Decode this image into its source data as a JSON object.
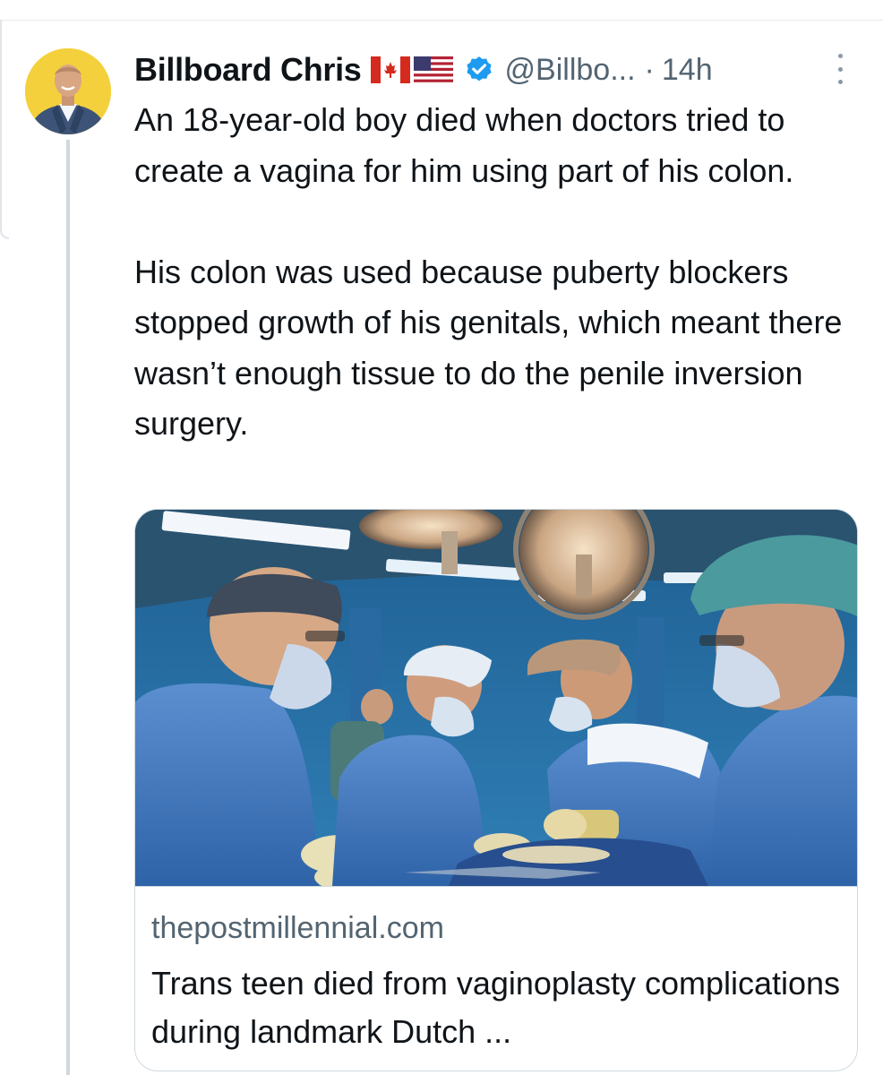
{
  "tweet": {
    "author_name": "Billboard Chris",
    "author_flags": [
      "canada-flag",
      "usa-flag"
    ],
    "verified_icon": "verified-badge-icon",
    "handle": "@Billbo...",
    "separator": "·",
    "time": "14h",
    "paragraphs": [
      "An 18-year-old boy died when doctors tried to create a vagina for him using part of his colon.",
      "His colon was used because puberty blockers stopped growth of his genitals, which meant there wasn’t enough tissue to do the penile inversion surgery."
    ]
  },
  "link_card": {
    "image_alt": "surgeons-operating-photo",
    "domain": "thepostmillennial.com",
    "title": "Trans teen died from vaginoplasty complications during landmark Dutch ..."
  },
  "colors": {
    "verified": "#1d9bf0",
    "secondary_text": "#536471",
    "thread_line": "#cfd9de",
    "avatar_bg": "#f4d13c"
  }
}
